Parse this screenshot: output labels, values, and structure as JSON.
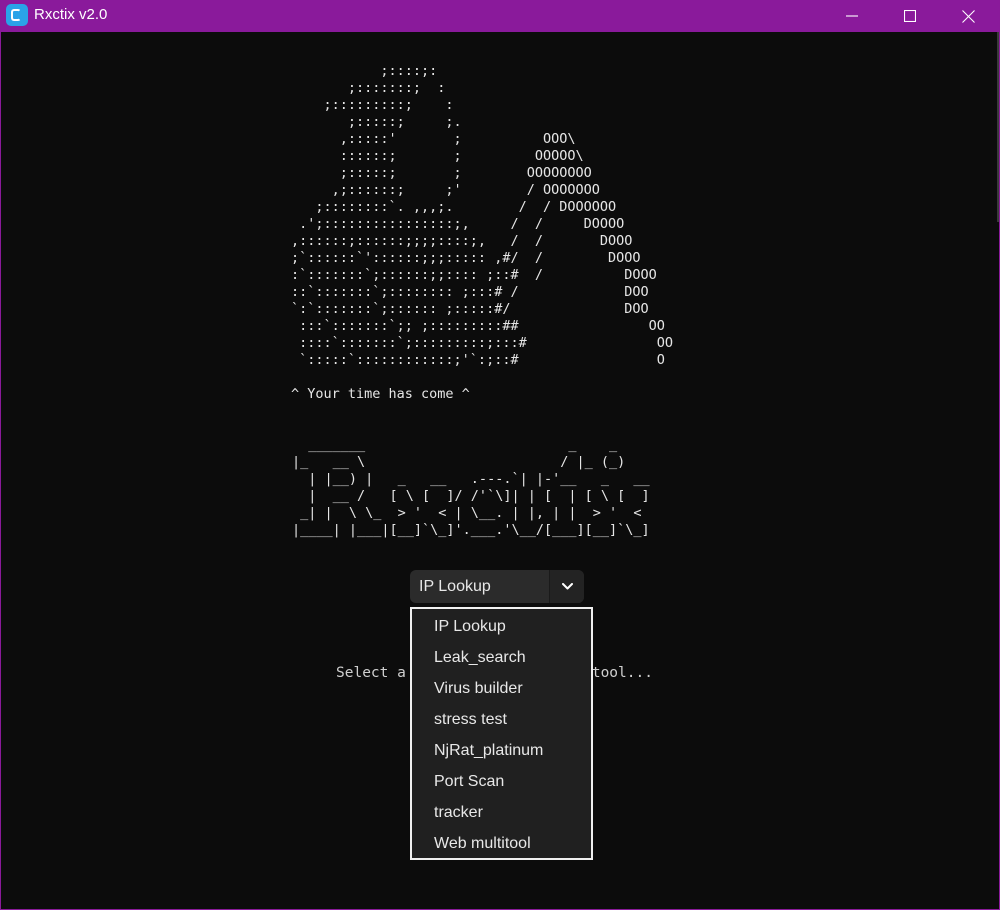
{
  "window": {
    "title": "Rxctix v2.0",
    "app_icon": "rxctix-logo-icon",
    "controls": [
      "minimize-icon",
      "maximize-icon",
      "close-icon"
    ]
  },
  "art": {
    "ascii_skull": "           ;::::;:\n       ;:::::::;  :\n    ;:::::::::;    :\n       ;:::::;     ;.\n      ,:::::'       ;          OOO\\\n      ::::::;       ;         OOOOO\\\n      ;:::::;       ;        OOOOOOOO\n     ,;::::::;     ;'        / OOOOOOO\n   ;::::::::`. ,,,;.        /  / DOOOOOO\n .';::::::::::::::::;,     /  /     DOOOO\n,::::::;::::::;;;;::::;,   /  /       DOOO\n;`::::::`'::::::;;;::::: ,#/  /        DOOO\n:`:::::::`;::::::;;:::: ;::#  /          DOOO\n::`:::::::`;:::::::: ;:::# /             DOO\n`:`:::::::`;:::::: ;:::::#/              DOO\n :::`:::::::`;; ;:::::::::##                OO\n ::::`:::::::`;:::::::::;:::#                OO\n `:::::`::::::::::::;'`:;::#                 O",
    "tagline": "^ Your time has come ^",
    "banner": "  _______                         _    _\n|_   __ \\                        / |_ (_)\n  | |__) |   _   __   .---.`| |-'__   _   __\n  |  __ /   [ \\ [  ]/ /'`\\]| | [  | [ \\ [  ]\n _| |  \\ \\_  > '  < | \\__. | |, | |  > '  <\n|____| |___|[__]`\\_]'.___.'\\__/[___][__]`\\_]"
  },
  "tool_select": {
    "selected": "IP Lookup",
    "arrow_icon": "chevron-down-icon",
    "options": [
      "IP Lookup",
      "Leak_search",
      "Virus builder",
      "stress test",
      "NjRat_platinum",
      "Port Scan",
      "tracker",
      "Web multitool"
    ]
  },
  "hint": {
    "left": "Select a",
    "right": "tool..."
  },
  "colors": {
    "titlebar": "#8a1a9b",
    "background": "#0c0c0c",
    "text": "#e6e6e6",
    "dropdown_bg": "#202020",
    "dropdown_border": "#f0f0f0"
  }
}
